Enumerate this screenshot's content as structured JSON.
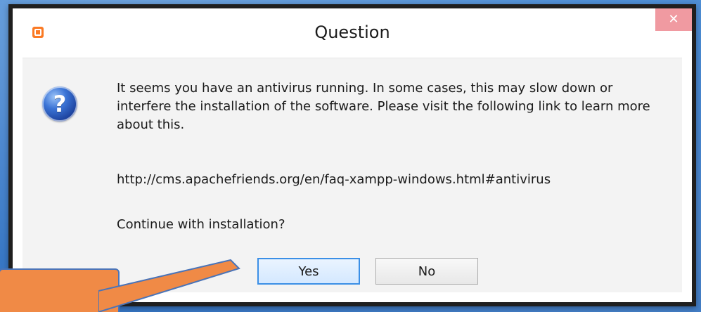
{
  "dialog": {
    "title": "Question",
    "close_label": "✕",
    "message": "It seems you have an antivirus running. In some cases, this may slow down or interfere the installation of the software. Please visit the following link to learn more about this.",
    "link": "http://cms.apachefriends.org/en/faq-xampp-windows.html#antivirus",
    "prompt": "Continue with installation?",
    "buttons": {
      "yes_label": "Yes",
      "no_label": "No"
    }
  },
  "colors": {
    "callout_fill": "#f08a46",
    "callout_border": "#4a74b8",
    "accent_blue": "#3b8fe6"
  },
  "icons": {
    "app": "xampp-icon",
    "question": "question-icon",
    "close": "close-icon"
  }
}
